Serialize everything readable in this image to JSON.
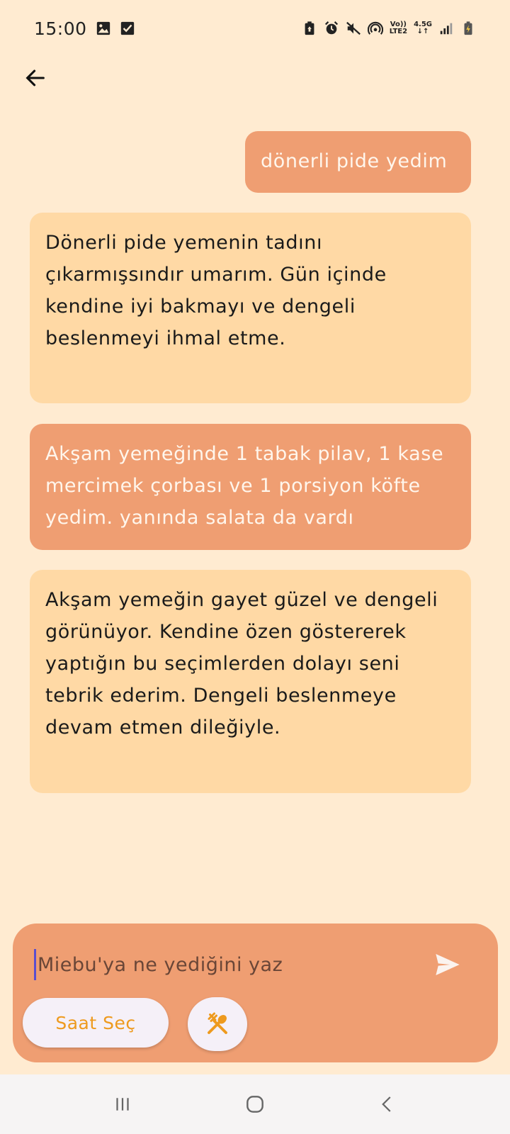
{
  "status_bar": {
    "time": "15:00",
    "icons": [
      "image-icon",
      "check-box-icon",
      "battery-saver-icon",
      "alarm-icon",
      "mute-icon",
      "hotspot-icon",
      "volte-icon",
      "network-4-5g-icon",
      "signal-icon",
      "battery-charging-icon"
    ],
    "volte_top": "Vo))",
    "volte_bottom": "LTE2",
    "network_top": "4.5G",
    "network_bottom": "↓↑"
  },
  "header": {
    "back_icon": "arrow-left-icon"
  },
  "messages": [
    {
      "role": "user",
      "text": "dönerli pide yedim"
    },
    {
      "role": "bot",
      "text": "Dönerli pide yemenin tadını çıkarmışsındır umarım. Gün içinde kendine iyi bakmayı ve dengeli beslenmeyi ihmal etme."
    },
    {
      "role": "user",
      "text": "Akşam yemeğinde 1 tabak pilav, 1 kase mercimek çorbası ve 1 porsiyon köfte yedim. yanında salata da vardı"
    },
    {
      "role": "bot",
      "text": "Akşam yemeğin gayet güzel ve dengeli görünüyor. Kendine özen göstererek yaptığın bu seçimlerden dolayı seni tebrik ederim. Dengeli beslenmeye devam etmen dileğiyle."
    }
  ],
  "composer": {
    "placeholder": "Miebu'ya ne yediğini yaz",
    "send_icon": "send-icon",
    "time_button_label": "Saat Seç",
    "meal_icon": "fork-spoon-icon"
  },
  "colors": {
    "background": "#FFEBD1",
    "user_bubble": "#EF9E72",
    "bot_bubble": "#FFD9A5",
    "accent": "#EE9A1E"
  },
  "nav": {
    "icons": [
      "recent-apps-icon",
      "home-icon",
      "back-icon"
    ]
  }
}
